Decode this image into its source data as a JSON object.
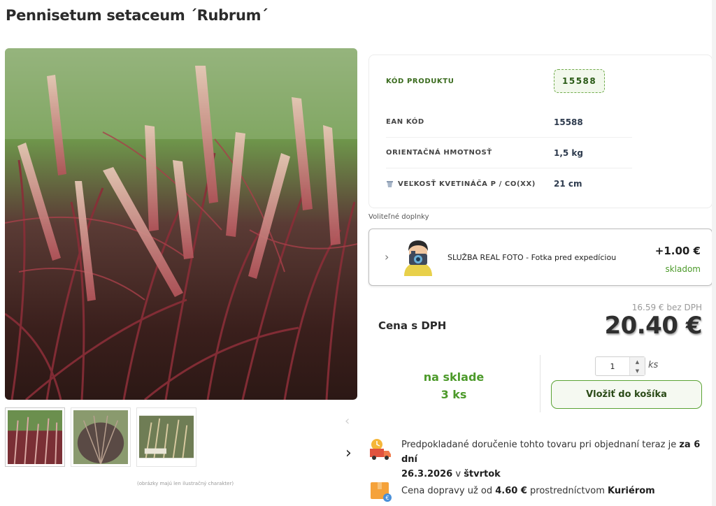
{
  "product": {
    "title": "Pennisetum setaceum ´Rubrum´",
    "image_note": "(obrázky majú len ilustračný charakter)"
  },
  "info": {
    "code_label": "KÓD PRODUKTU",
    "code_value": "15588",
    "ean_label": "EAN KÓD",
    "ean_value": "15588",
    "weight_label": "ORIENTAČNÁ HMOTNOSŤ",
    "weight_value": "1,5 kg",
    "pot_label": "VEĽKOSŤ KVETINÁČA P / CO(XX)",
    "pot_value": "21 cm"
  },
  "addons": {
    "section_label": "Voliteľné doplnky",
    "item": {
      "name": "SLUŽBA REAL FOTO - Fotka pred expedíciou",
      "price": "+1.00 €",
      "stock": "skladom",
      "icon": "photographer-icon"
    }
  },
  "pricing": {
    "net_price": "16.59 € bez DPH",
    "label": "Cena s DPH",
    "gross_price": "20.40 €"
  },
  "stock": {
    "status": "na sklade",
    "count": "3 ks"
  },
  "cart": {
    "quantity": "1",
    "unit": "ks",
    "button_label": "Vložiť do košíka"
  },
  "delivery": {
    "text_prefix": "Predpokladané doručenie tohto tovaru pri objednaní teraz je",
    "days": "za 6 dní",
    "date": "26.3.2026",
    "weekday_prefix": "v",
    "weekday": "štvrtok",
    "icon": "delivery-truck-icon"
  },
  "shipping": {
    "text_prefix": "Cena dopravy už od",
    "price": "4.60 €",
    "via": "prostredníctvom",
    "carrier": "Kuriérom",
    "icon": "package-icon"
  },
  "colors": {
    "accent_green": "#4c9a2a",
    "badge_bg": "#f2f8ec"
  }
}
